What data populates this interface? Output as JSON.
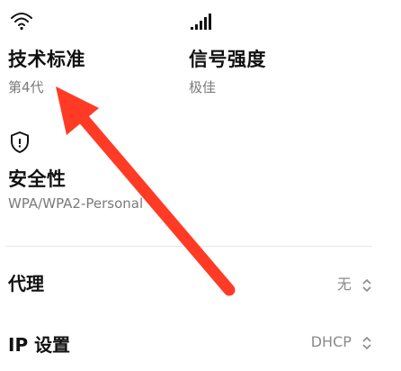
{
  "colors": {
    "accent_arrow": "#ff3b25",
    "muted": "#7a7a7a"
  },
  "icons": {
    "wifi": "wifi-icon",
    "signal": "signal-bars-icon",
    "security": "shield-icon",
    "stepper": "chevron-up-down-icon"
  },
  "tech_standard": {
    "label": "技术标准",
    "value": "第4代"
  },
  "signal_strength": {
    "label": "信号强度",
    "value": "极佳"
  },
  "security": {
    "label": "安全性",
    "value": "WPA/WPA2-Personal"
  },
  "proxy": {
    "label": "代理",
    "value": "无"
  },
  "ip_settings": {
    "label": "IP 设置",
    "value": "DHCP"
  }
}
